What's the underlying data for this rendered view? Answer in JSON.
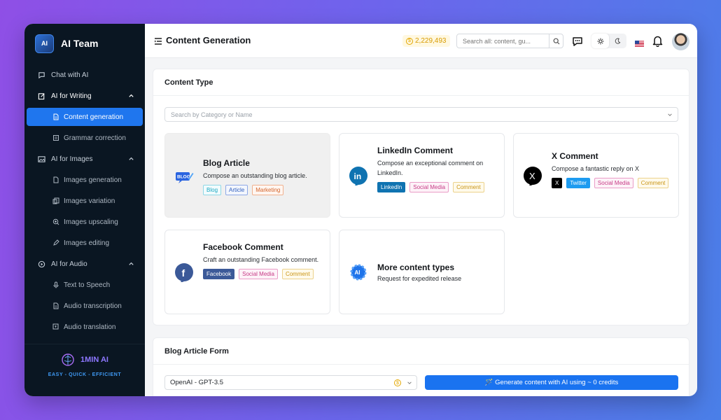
{
  "app": {
    "name": "AI Team",
    "logo_text": "AI"
  },
  "sidebar": {
    "groups": [
      {
        "label": "Chat with AI"
      },
      {
        "label": "AI for Writing",
        "items": [
          {
            "label": "Content generation"
          },
          {
            "label": "Grammar correction"
          }
        ]
      },
      {
        "label": "AI for Images",
        "items": [
          {
            "label": "Images generation"
          },
          {
            "label": "Images variation"
          },
          {
            "label": "Images upscaling"
          },
          {
            "label": "Images editing"
          }
        ]
      },
      {
        "label": "AI for Audio",
        "items": [
          {
            "label": "Text to Speech"
          },
          {
            "label": "Audio transcription"
          },
          {
            "label": "Audio translation"
          }
        ]
      }
    ],
    "footer": {
      "brand": "1MIN AI",
      "tagline": "EASY - QUICK - EFFICIENT"
    }
  },
  "header": {
    "title": "Content Generation",
    "credits": "2,229,493",
    "search_placeholder": "Search all: content, gu..."
  },
  "content_type": {
    "heading": "Content Type",
    "search_placeholder": "Search by Category or Name",
    "tiles": [
      {
        "title": "Blog Article",
        "desc": "Compose an outstanding blog article.",
        "icon_text": "BLOG",
        "tags": [
          "Blog",
          "Article",
          "Marketing"
        ]
      },
      {
        "title": "LinkedIn Comment",
        "desc": "Compose an exceptional comment on LinkedIn.",
        "icon_text": "in",
        "tags": [
          "LinkedIn",
          "Social Media",
          "Comment"
        ]
      },
      {
        "title": "X Comment",
        "desc": "Compose a fantastic reply on X",
        "icon_text": "X",
        "tags": [
          "X",
          "Twitter",
          "Social Media",
          "Comment"
        ]
      },
      {
        "title": "Facebook Comment",
        "desc": "Craft an outstanding Facebook comment.",
        "icon_text": "f",
        "tags": [
          "Facebook",
          "Social Media",
          "Comment"
        ]
      },
      {
        "title": "More content types",
        "desc": "Request for expedited release",
        "icon_text": "AI"
      }
    ]
  },
  "form": {
    "heading": "Blog Article Form",
    "model": "OpenAI - GPT-3.5",
    "generate_label": "🪄 Generate content with AI using ~ 0 credits"
  },
  "colors": {
    "accent": "#1a73f0",
    "sidebar_bg": "#0a1622",
    "credits": "#d89b00"
  },
  "icons": [
    "chat-icon",
    "edit-icon",
    "document-icon",
    "image-icon",
    "audio-icon",
    "search-icon",
    "bell-icon",
    "sun-icon",
    "moon-icon",
    "flag-us-icon"
  ]
}
